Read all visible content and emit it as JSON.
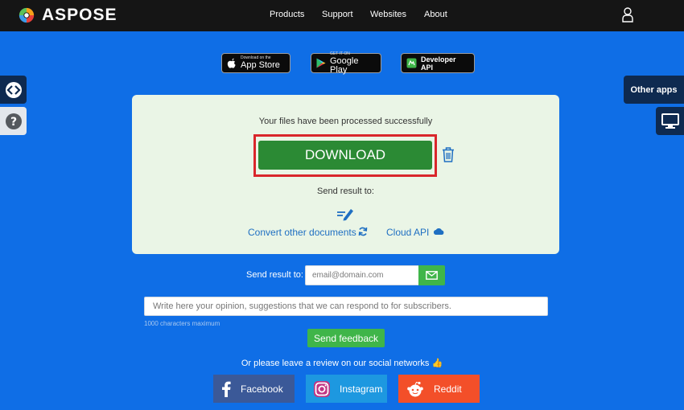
{
  "header": {
    "brand": "ASPOSE",
    "nav": [
      "Products",
      "Support",
      "Websites",
      "About"
    ],
    "user_icon": "user-icon"
  },
  "badges": {
    "appstore_small": "Download on the",
    "appstore_big": "App Store",
    "googleplay_small": "GET IT ON",
    "googleplay_big": "Google Play",
    "developer_api": "Developer API"
  },
  "side": {
    "left_icons": [
      "code-arrows-icon",
      "help-icon"
    ],
    "other_apps": "Other apps",
    "right_icon": "monitor-icon"
  },
  "result": {
    "message": "Your files have been processed successfully",
    "download_label": "DOWNLOAD",
    "send_result_label": "Send result to:",
    "convert_label": "Convert other documents",
    "cloud_label": "Cloud API"
  },
  "email": {
    "label": "Send result to:",
    "placeholder": "email@domain.com",
    "value": ""
  },
  "feedback": {
    "placeholder": "Write here your opinion, suggestions that we can respond to for subscribers.",
    "value": "",
    "char_limit_note": "1000 characters maximum",
    "button_label": "Send feedback"
  },
  "review": {
    "text": "Or please leave a review on our social networks 👍"
  },
  "social": {
    "facebook": "Facebook",
    "instagram": "Instagram",
    "reddit": "Reddit"
  },
  "colors": {
    "page_bg": "#0f6ee6",
    "nav_bg": "#151515",
    "card_bg": "#eaf5e6",
    "download_green": "#2b8a34",
    "highlight_red": "#d9262b",
    "action_green": "#3fb549",
    "link_blue": "#1f6fc2",
    "facebook": "#3b5998",
    "instagram": "#1d98e0",
    "reddit": "#f34f29"
  }
}
